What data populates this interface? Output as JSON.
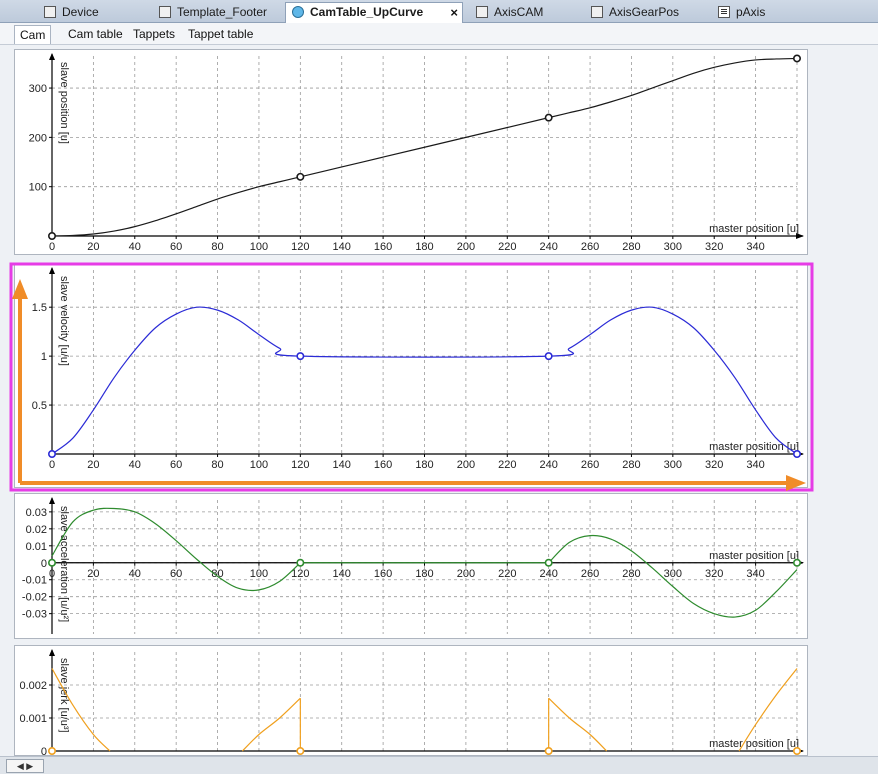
{
  "tabs": [
    {
      "label": "Device",
      "icon": "device-icon",
      "left": 0
    },
    {
      "label": "Template_Footer",
      "icon": "pou-icon"
    },
    {
      "label": "CamTable_UpCurve",
      "icon": "cam-icon",
      "active": true
    },
    {
      "label": "AxisCAM",
      "icon": "pou-icon"
    },
    {
      "label": "AxisGearPos",
      "icon": "pou-icon"
    },
    {
      "label": "pAxis",
      "icon": "code-icon"
    }
  ],
  "close_symbol": "×",
  "subtabs": [
    "Cam",
    "Cam table",
    "Tappets",
    "Tappet table"
  ],
  "status": {
    "button_label": "◀ ▶"
  },
  "colors": {
    "position": "#1a1a1a",
    "velocity": "#2b2bd6",
    "acceleration": "#2e8b2e",
    "jerk": "#f0a01e",
    "highlight": "#e63ce6",
    "arrow": "#f08c28"
  },
  "chart_data": [
    {
      "type": "line",
      "title": "",
      "xlabel": "master position [u]",
      "ylabel": "slave position [u]",
      "xlim": [
        0,
        360
      ],
      "ylim": [
        0,
        365
      ],
      "xticks": [
        0,
        20,
        40,
        60,
        80,
        100,
        120,
        140,
        160,
        180,
        200,
        220,
        240,
        260,
        280,
        300,
        320,
        340
      ],
      "yticks": [
        100,
        200,
        300
      ],
      "grid": true,
      "series": [
        {
          "x": [
            0,
            10,
            20,
            30,
            40,
            50,
            60,
            70,
            80,
            90,
            100,
            110,
            120,
            140,
            160,
            180,
            200,
            220,
            240,
            250,
            260,
            270,
            280,
            290,
            300,
            310,
            320,
            330,
            340,
            350,
            360
          ],
          "values": [
            0,
            1,
            4,
            10,
            19,
            31,
            45,
            60,
            75,
            88,
            100,
            110,
            120,
            140,
            160,
            180,
            200,
            220,
            240,
            250,
            260,
            272,
            285,
            300,
            315,
            330,
            342,
            351,
            357,
            359,
            360
          ]
        }
      ],
      "points": {
        "x": [
          0,
          120,
          240,
          360
        ],
        "values": [
          0,
          120,
          240,
          360
        ]
      }
    },
    {
      "type": "line",
      "title": "",
      "xlabel": "master position [u]",
      "ylabel": "slave velocity [u/u]",
      "xlim": [
        0,
        360
      ],
      "ylim": [
        0,
        1.88
      ],
      "xticks": [
        0,
        20,
        40,
        60,
        80,
        100,
        120,
        140,
        160,
        180,
        200,
        220,
        240,
        260,
        280,
        300,
        320,
        340
      ],
      "yticks": [
        0.5,
        1,
        1.5
      ],
      "grid": true,
      "series": [
        {
          "x": [
            0,
            10,
            20,
            30,
            40,
            50,
            60,
            70,
            80,
            90,
            100,
            110,
            120,
            240,
            250,
            260,
            270,
            280,
            290,
            300,
            310,
            320,
            330,
            340,
            350,
            360
          ],
          "values": [
            0,
            0.16,
            0.45,
            0.78,
            1.06,
            1.29,
            1.43,
            1.5,
            1.47,
            1.37,
            1.22,
            1.08,
            1.0,
            1.0,
            1.08,
            1.22,
            1.37,
            1.47,
            1.5,
            1.43,
            1.29,
            1.06,
            0.78,
            0.45,
            0.16,
            0
          ]
        }
      ],
      "points": {
        "x": [
          0,
          120,
          240,
          360
        ],
        "values": [
          0,
          1,
          1,
          0
        ]
      }
    },
    {
      "type": "line",
      "title": "",
      "xlabel": "master position [u]",
      "ylabel": "slave acceleration [u/u²]",
      "xlim": [
        0,
        360
      ],
      "ylim": [
        -0.042,
        0.037
      ],
      "xticks": [
        0,
        20,
        40,
        60,
        80,
        100,
        120,
        140,
        160,
        180,
        200,
        220,
        240,
        260,
        280,
        300,
        320,
        340
      ],
      "yticks": [
        -0.03,
        -0.02,
        -0.01,
        0,
        0.01,
        0.02,
        0.03
      ],
      "grid": true,
      "series": [
        {
          "x": [
            0,
            10,
            20,
            30,
            40,
            50,
            60,
            70,
            80,
            90,
            100,
            110,
            120
          ],
          "values": [
            0.004,
            0.024,
            0.031,
            0.032,
            0.03,
            0.023,
            0.013,
            0.002,
            -0.008,
            -0.015,
            -0.016,
            -0.011,
            0
          ]
        },
        {
          "x": [
            120,
            240
          ],
          "values": [
            0,
            0
          ]
        },
        {
          "x": [
            240,
            250,
            260,
            270,
            280,
            290,
            300,
            310,
            320,
            330,
            340,
            350,
            360
          ],
          "values": [
            0,
            0.012,
            0.016,
            0.014,
            0.007,
            -0.003,
            -0.014,
            -0.024,
            -0.03,
            -0.032,
            -0.028,
            -0.017,
            -0.004
          ]
        }
      ],
      "points": {
        "x": [
          0,
          120,
          240,
          360
        ],
        "values": [
          0,
          0,
          0,
          0
        ]
      }
    },
    {
      "type": "line",
      "title": "",
      "xlabel": "master position [u]",
      "ylabel": "slave jerk [u/u³]",
      "xlim": [
        0,
        360
      ],
      "ylim": [
        0,
        0.003
      ],
      "xticks": [],
      "yticks": [
        0,
        0.001,
        0.002
      ],
      "grid": true,
      "series": [
        {
          "x": [
            0,
            10,
            20,
            28
          ],
          "values": [
            0.0025,
            0.0014,
            0.0005,
            0
          ]
        },
        {
          "x": [
            92,
            100,
            110,
            120
          ],
          "values": [
            0,
            0.0005,
            0.001,
            0.0016
          ]
        },
        {
          "x": [
            120,
            120
          ],
          "values": [
            0.0016,
            0
          ]
        },
        {
          "x": [
            240,
            240
          ],
          "values": [
            0,
            0.0016
          ]
        },
        {
          "x": [
            240,
            250,
            260,
            268
          ],
          "values": [
            0.0016,
            0.001,
            0.0005,
            0
          ]
        },
        {
          "x": [
            332,
            340,
            350,
            360
          ],
          "values": [
            0,
            0.0008,
            0.0017,
            0.0025
          ]
        }
      ],
      "points": {
        "x": [
          0,
          120,
          240,
          360
        ],
        "values": [
          0,
          0,
          0,
          0
        ]
      }
    }
  ]
}
